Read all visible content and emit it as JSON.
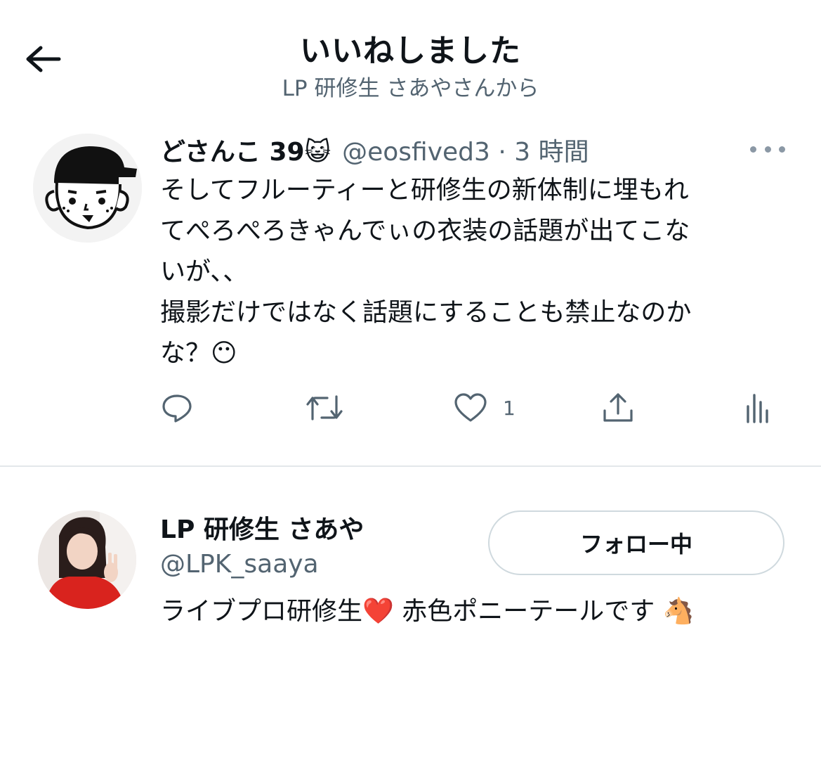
{
  "header": {
    "title": "いいねしました",
    "subtitle": "LP 研修生 さあやさんから"
  },
  "tweet": {
    "name": "どさんこ 39😺",
    "handle": "@eosfived3 · 3 時間",
    "text": "そしてフルーティーと研修生の新体制に埋もれ\nてぺろぺろきゃんでぃの衣装の話題が出てこな\nいが、、\n撮影だけではなく話題にすることも禁止なのか\nな？😶",
    "like_count": "1"
  },
  "user": {
    "name": "LP 研修生 さあや",
    "handle": "@LPK_saaya",
    "follow_label": "フォロー中",
    "bio": "ライブプロ研修生❤️ 赤色ポニーテールです 🐴"
  },
  "colors": {
    "text": "#0f1419",
    "secondary": "#536471",
    "divider": "#e3e7ea",
    "button_border": "#cfd9de"
  },
  "icons": [
    "back-arrow-icon",
    "more-icon",
    "reply-icon",
    "retweet-icon",
    "like-icon",
    "share-icon",
    "analytics-icon"
  ]
}
